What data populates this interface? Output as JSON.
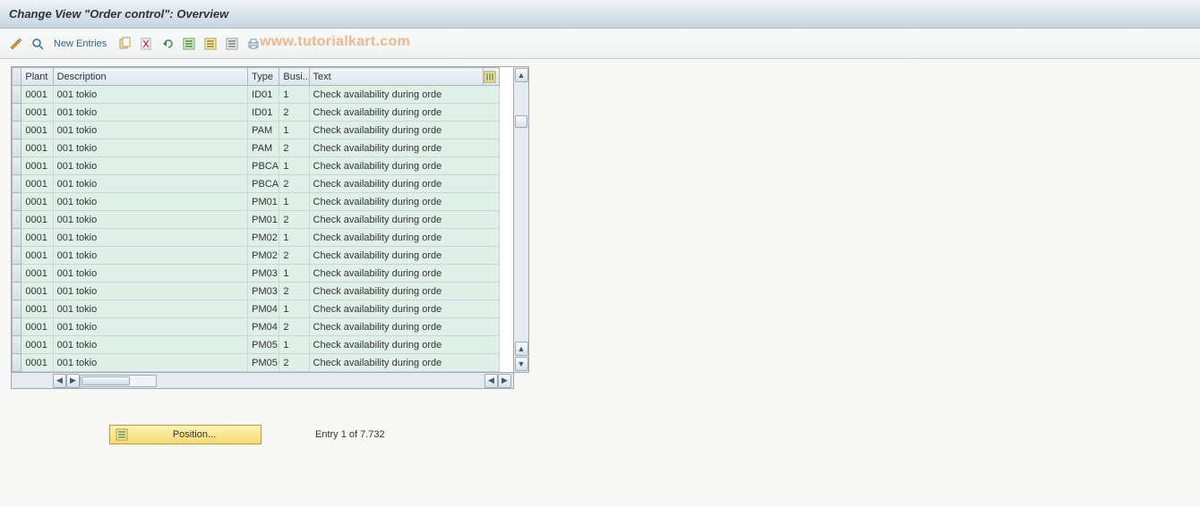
{
  "title": "Change View \"Order control\": Overview",
  "toolbar": {
    "new_entries_label": "New Entries"
  },
  "watermark": "www.tutorialkart.com",
  "columns": {
    "plant": "Plant",
    "description": "Description",
    "type": "Type",
    "busi": "Busi...",
    "text": "Text"
  },
  "rows": [
    {
      "plant": "0001",
      "description": "001 tokio",
      "type": "ID01",
      "busi": "1",
      "text": "Check availability during orde"
    },
    {
      "plant": "0001",
      "description": "001 tokio",
      "type": "ID01",
      "busi": "2",
      "text": "Check availability during orde"
    },
    {
      "plant": "0001",
      "description": "001 tokio",
      "type": "PAM",
      "busi": "1",
      "text": "Check availability during orde"
    },
    {
      "plant": "0001",
      "description": "001 tokio",
      "type": "PAM",
      "busi": "2",
      "text": "Check availability during orde"
    },
    {
      "plant": "0001",
      "description": "001 tokio",
      "type": "PBCA",
      "busi": "1",
      "text": "Check availability during orde"
    },
    {
      "plant": "0001",
      "description": "001 tokio",
      "type": "PBCA",
      "busi": "2",
      "text": "Check availability during orde"
    },
    {
      "plant": "0001",
      "description": "001 tokio",
      "type": "PM01",
      "busi": "1",
      "text": "Check availability during orde"
    },
    {
      "plant": "0001",
      "description": "001 tokio",
      "type": "PM01",
      "busi": "2",
      "text": "Check availability during orde"
    },
    {
      "plant": "0001",
      "description": "001 tokio",
      "type": "PM02",
      "busi": "1",
      "text": "Check availability during orde"
    },
    {
      "plant": "0001",
      "description": "001 tokio",
      "type": "PM02",
      "busi": "2",
      "text": "Check availability during orde"
    },
    {
      "plant": "0001",
      "description": "001 tokio",
      "type": "PM03",
      "busi": "1",
      "text": "Check availability during orde"
    },
    {
      "plant": "0001",
      "description": "001 tokio",
      "type": "PM03",
      "busi": "2",
      "text": "Check availability during orde"
    },
    {
      "plant": "0001",
      "description": "001 tokio",
      "type": "PM04",
      "busi": "1",
      "text": "Check availability during orde"
    },
    {
      "plant": "0001",
      "description": "001 tokio",
      "type": "PM04",
      "busi": "2",
      "text": "Check availability during orde"
    },
    {
      "plant": "0001",
      "description": "001 tokio",
      "type": "PM05",
      "busi": "1",
      "text": "Check availability during orde"
    },
    {
      "plant": "0001",
      "description": "001 tokio",
      "type": "PM05",
      "busi": "2",
      "text": "Check availability during orde"
    }
  ],
  "footer": {
    "position_label": "Position...",
    "entry_text": "Entry 1 of 7.732"
  }
}
